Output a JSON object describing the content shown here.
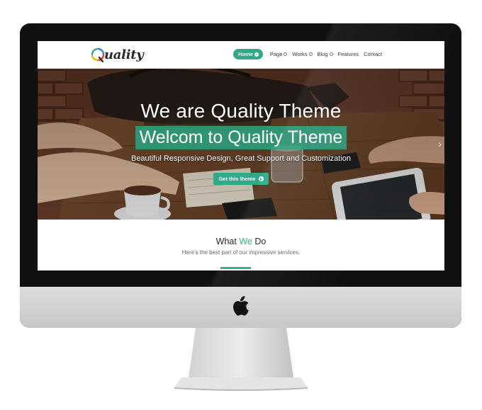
{
  "site": {
    "logo_text": "uality",
    "logo_letter": "Q"
  },
  "nav": {
    "items": [
      {
        "label": "Home",
        "active": true
      },
      {
        "label": "Page"
      },
      {
        "label": "Works"
      },
      {
        "label": "Blog"
      },
      {
        "label": "Features"
      },
      {
        "label": "Contact"
      }
    ]
  },
  "hero": {
    "title": "We are Quality Theme",
    "subtitle": "Welcom to Quality Theme",
    "tagline": "Beautiful Responsive Design, Great Support and Customization",
    "button_label": "Get this theme",
    "next_glyph": "›"
  },
  "services": {
    "title_prefix": "What ",
    "title_accent": "We",
    "title_suffix": " Do",
    "description": "Here's the best part of our impressive services."
  },
  "colors": {
    "accent": "#2fa987",
    "monitor_bezel": "#101010",
    "monitor_chin": "#d0d0d0"
  },
  "icons": {
    "device": "apple-logo",
    "nav_arrow": "chevron-right-icon"
  }
}
